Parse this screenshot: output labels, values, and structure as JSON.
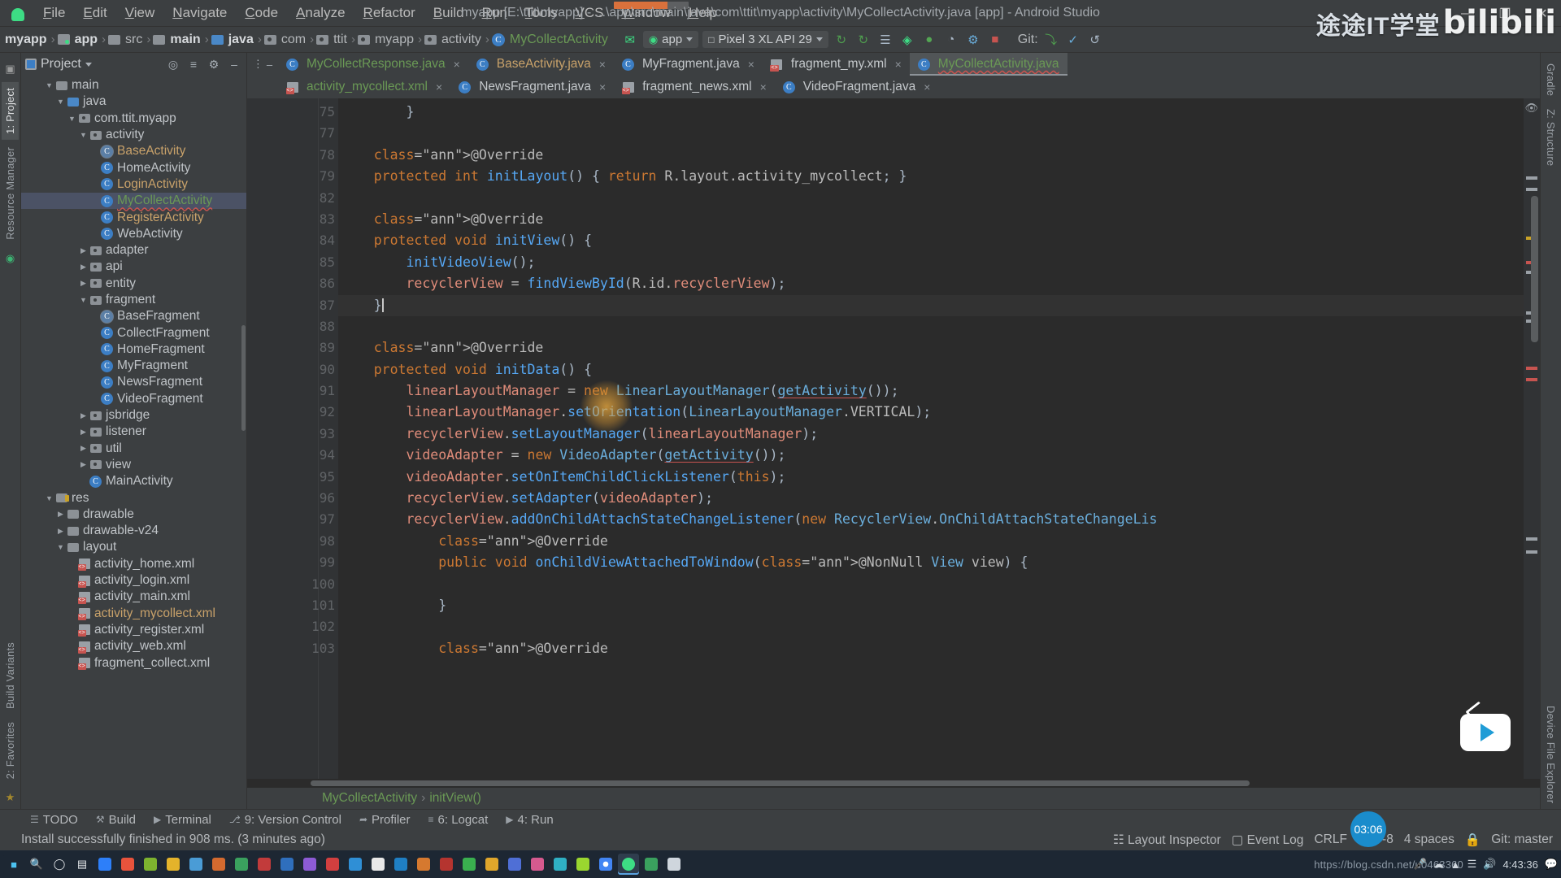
{
  "titlebar": {
    "menus": [
      "File",
      "Edit",
      "View",
      "Navigate",
      "Code",
      "Analyze",
      "Refactor",
      "Build",
      "Run",
      "Tools",
      "VCS",
      "Window",
      "Help"
    ],
    "window_title": "myapp [E:\\ttit\\myapp] - ...\\app\\src\\main\\java\\com\\ttit\\myapp\\activity\\MyCollectActivity.java [app] - Android Studio",
    "minimize": "—",
    "maximize": "❐",
    "close": "✕"
  },
  "navbar": {
    "breadcrumbs": [
      {
        "label": "myapp",
        "icon": "none",
        "bold": true
      },
      {
        "label": "app",
        "icon": "module",
        "bold": true
      },
      {
        "label": "src",
        "icon": "folder"
      },
      {
        "label": "main",
        "icon": "folder",
        "bold": true
      },
      {
        "label": "java",
        "icon": "folder-blue",
        "bold": true
      },
      {
        "label": "com",
        "icon": "package"
      },
      {
        "label": "ttit",
        "icon": "package"
      },
      {
        "label": "myapp",
        "icon": "package"
      },
      {
        "label": "activity",
        "icon": "package"
      },
      {
        "label": "MyCollectActivity",
        "icon": "class",
        "active": true
      }
    ],
    "run_config": "app",
    "device": "Pixel 3 XL API 29",
    "git_label": "Git:",
    "watermark_cn": "途途IT学堂",
    "watermark_bili": "bilibili"
  },
  "project_panel": {
    "title": "Project",
    "tree": [
      {
        "depth": 2,
        "twist": "▼",
        "icon": "folder",
        "label": "main"
      },
      {
        "depth": 3,
        "twist": "▼",
        "icon": "folder-blue",
        "label": "java"
      },
      {
        "depth": 4,
        "twist": "▼",
        "icon": "package",
        "label": "com.ttit.myapp"
      },
      {
        "depth": 5,
        "twist": "▼",
        "icon": "package",
        "label": "activity"
      },
      {
        "depth": 6,
        "twist": "",
        "icon": "class-abstract",
        "label": "BaseActivity",
        "color": "orange"
      },
      {
        "depth": 6,
        "twist": "",
        "icon": "class",
        "label": "HomeActivity"
      },
      {
        "depth": 6,
        "twist": "",
        "icon": "class",
        "label": "LoginActivity",
        "color": "orange"
      },
      {
        "depth": 6,
        "twist": "",
        "icon": "class",
        "label": "MyCollectActivity",
        "color": "green",
        "selected": true
      },
      {
        "depth": 6,
        "twist": "",
        "icon": "class",
        "label": "RegisterActivity",
        "color": "orange"
      },
      {
        "depth": 6,
        "twist": "",
        "icon": "class",
        "label": "WebActivity"
      },
      {
        "depth": 5,
        "twist": "▶",
        "icon": "package",
        "label": "adapter"
      },
      {
        "depth": 5,
        "twist": "▶",
        "icon": "package",
        "label": "api"
      },
      {
        "depth": 5,
        "twist": "▶",
        "icon": "package",
        "label": "entity"
      },
      {
        "depth": 5,
        "twist": "▼",
        "icon": "package",
        "label": "fragment"
      },
      {
        "depth": 6,
        "twist": "",
        "icon": "class-abstract",
        "label": "BaseFragment"
      },
      {
        "depth": 6,
        "twist": "",
        "icon": "class",
        "label": "CollectFragment"
      },
      {
        "depth": 6,
        "twist": "",
        "icon": "class",
        "label": "HomeFragment"
      },
      {
        "depth": 6,
        "twist": "",
        "icon": "class",
        "label": "MyFragment"
      },
      {
        "depth": 6,
        "twist": "",
        "icon": "class",
        "label": "NewsFragment"
      },
      {
        "depth": 6,
        "twist": "",
        "icon": "class",
        "label": "VideoFragment"
      },
      {
        "depth": 5,
        "twist": "▶",
        "icon": "package",
        "label": "jsbridge"
      },
      {
        "depth": 5,
        "twist": "▶",
        "icon": "package",
        "label": "listener"
      },
      {
        "depth": 5,
        "twist": "▶",
        "icon": "package",
        "label": "util"
      },
      {
        "depth": 5,
        "twist": "▶",
        "icon": "package",
        "label": "view"
      },
      {
        "depth": 5,
        "twist": "",
        "icon": "class",
        "label": "MainActivity"
      },
      {
        "depth": 2,
        "twist": "▼",
        "icon": "folder-res",
        "label": "res"
      },
      {
        "depth": 3,
        "twist": "▶",
        "icon": "folder",
        "label": "drawable"
      },
      {
        "depth": 3,
        "twist": "▶",
        "icon": "folder",
        "label": "drawable-v24"
      },
      {
        "depth": 3,
        "twist": "▼",
        "icon": "folder",
        "label": "layout"
      },
      {
        "depth": 4,
        "twist": "",
        "icon": "xml",
        "label": "activity_home.xml"
      },
      {
        "depth": 4,
        "twist": "",
        "icon": "xml",
        "label": "activity_login.xml"
      },
      {
        "depth": 4,
        "twist": "",
        "icon": "xml",
        "label": "activity_main.xml"
      },
      {
        "depth": 4,
        "twist": "",
        "icon": "xml",
        "label": "activity_mycollect.xml",
        "color": "orange"
      },
      {
        "depth": 4,
        "twist": "",
        "icon": "xml",
        "label": "activity_register.xml"
      },
      {
        "depth": 4,
        "twist": "",
        "icon": "xml",
        "label": "activity_web.xml"
      },
      {
        "depth": 4,
        "twist": "",
        "icon": "xml",
        "label": "fragment_collect.xml"
      }
    ]
  },
  "left_rail": [
    {
      "label": "1: Project",
      "selected": true
    },
    {
      "label": "Resource Manager",
      "selected": false
    },
    {
      "label": "Build Variants",
      "selected": false
    },
    {
      "label": "2: Favorites",
      "selected": false
    }
  ],
  "right_rail": [
    {
      "label": "Gradle"
    },
    {
      "label": "Z: Structure"
    },
    {
      "label": "Device File Explorer"
    }
  ],
  "editor": {
    "tabs_row1": [
      {
        "label": "MyCollectResponse.java",
        "icon": "class",
        "color": "green",
        "closable": true
      },
      {
        "label": "BaseActivity.java",
        "icon": "class",
        "color": "orange",
        "closable": true
      },
      {
        "label": "MyFragment.java",
        "icon": "class",
        "color": "grey",
        "closable": true
      },
      {
        "label": "fragment_my.xml",
        "icon": "xml",
        "color": "grey",
        "closable": true
      },
      {
        "label": "MyCollectActivity.java",
        "icon": "class",
        "color": "green",
        "active": true,
        "closable": false
      }
    ],
    "tabs_row2": [
      {
        "label": "activity_mycollect.xml",
        "icon": "xml",
        "color": "green",
        "closable": true
      },
      {
        "label": "NewsFragment.java",
        "icon": "class",
        "color": "grey",
        "closable": true
      },
      {
        "label": "fragment_news.xml",
        "icon": "xml",
        "color": "grey",
        "closable": true
      },
      {
        "label": "VideoFragment.java",
        "icon": "class",
        "color": "grey",
        "closable": true
      }
    ],
    "line_numbers": [
      "75",
      "77",
      "78",
      "79",
      "82",
      "83",
      "84",
      "85",
      "86",
      "87",
      "88",
      "89",
      "90",
      "91",
      "92",
      "93",
      "94",
      "95",
      "96",
      "97",
      "98",
      "99",
      "100",
      "101",
      "102",
      "103"
    ],
    "code_lines": [
      "        }",
      "",
      "    @Override",
      "    protected int initLayout() { return R.layout.activity_mycollect; }",
      "",
      "    @Override",
      "    protected void initView() {",
      "        initVideoView();",
      "        recyclerView = findViewById(R.id.recyclerView);",
      "    }",
      "",
      "    @Override",
      "    protected void initData() {",
      "        linearLayoutManager = new LinearLayoutManager(getActivity());",
      "        linearLayoutManager.setOrientation(LinearLayoutManager.VERTICAL);",
      "        recyclerView.setLayoutManager(linearLayoutManager);",
      "        videoAdapter = new VideoAdapter(getActivity());",
      "        videoAdapter.setOnItemChildClickListener(this);",
      "        recyclerView.setAdapter(videoAdapter);",
      "        recyclerView.addOnChildAttachStateChangeListener(new RecyclerView.OnChildAttachStateChangeLis",
      "            @Override",
      "            public void onChildViewAttachedToWindow(@NonNull View view) {",
      "",
      "            }",
      "",
      "            @Override"
    ],
    "breadcrumb_footer": [
      "MyCollectActivity",
      "initView()"
    ]
  },
  "tool_windows": [
    {
      "icon": "todo-icon",
      "label": "TODO"
    },
    {
      "icon": "build-icon",
      "label": "Build"
    },
    {
      "icon": "terminal-icon",
      "label": "Terminal"
    },
    {
      "icon": "vcs-icon",
      "label": "9: Version Control"
    },
    {
      "icon": "profiler-icon",
      "label": "Profiler"
    },
    {
      "icon": "logcat-icon",
      "label": "6: Logcat"
    },
    {
      "icon": "run-icon",
      "label": "4: Run"
    }
  ],
  "statusbar": {
    "message": "Install successfully finished in 908 ms. (3 minutes ago)",
    "layout_inspector": "Layout Inspector",
    "event_log": "Event Log",
    "line_sep": "CRLF",
    "encoding": "UTF-8",
    "indent": "4 spaces",
    "branch": "Git: master",
    "lock": "🔒",
    "clock": "03:06"
  },
  "taskbar": {
    "time": "4:43:36",
    "url_watermark": "https://blog.csdn.net/u0463360"
  }
}
